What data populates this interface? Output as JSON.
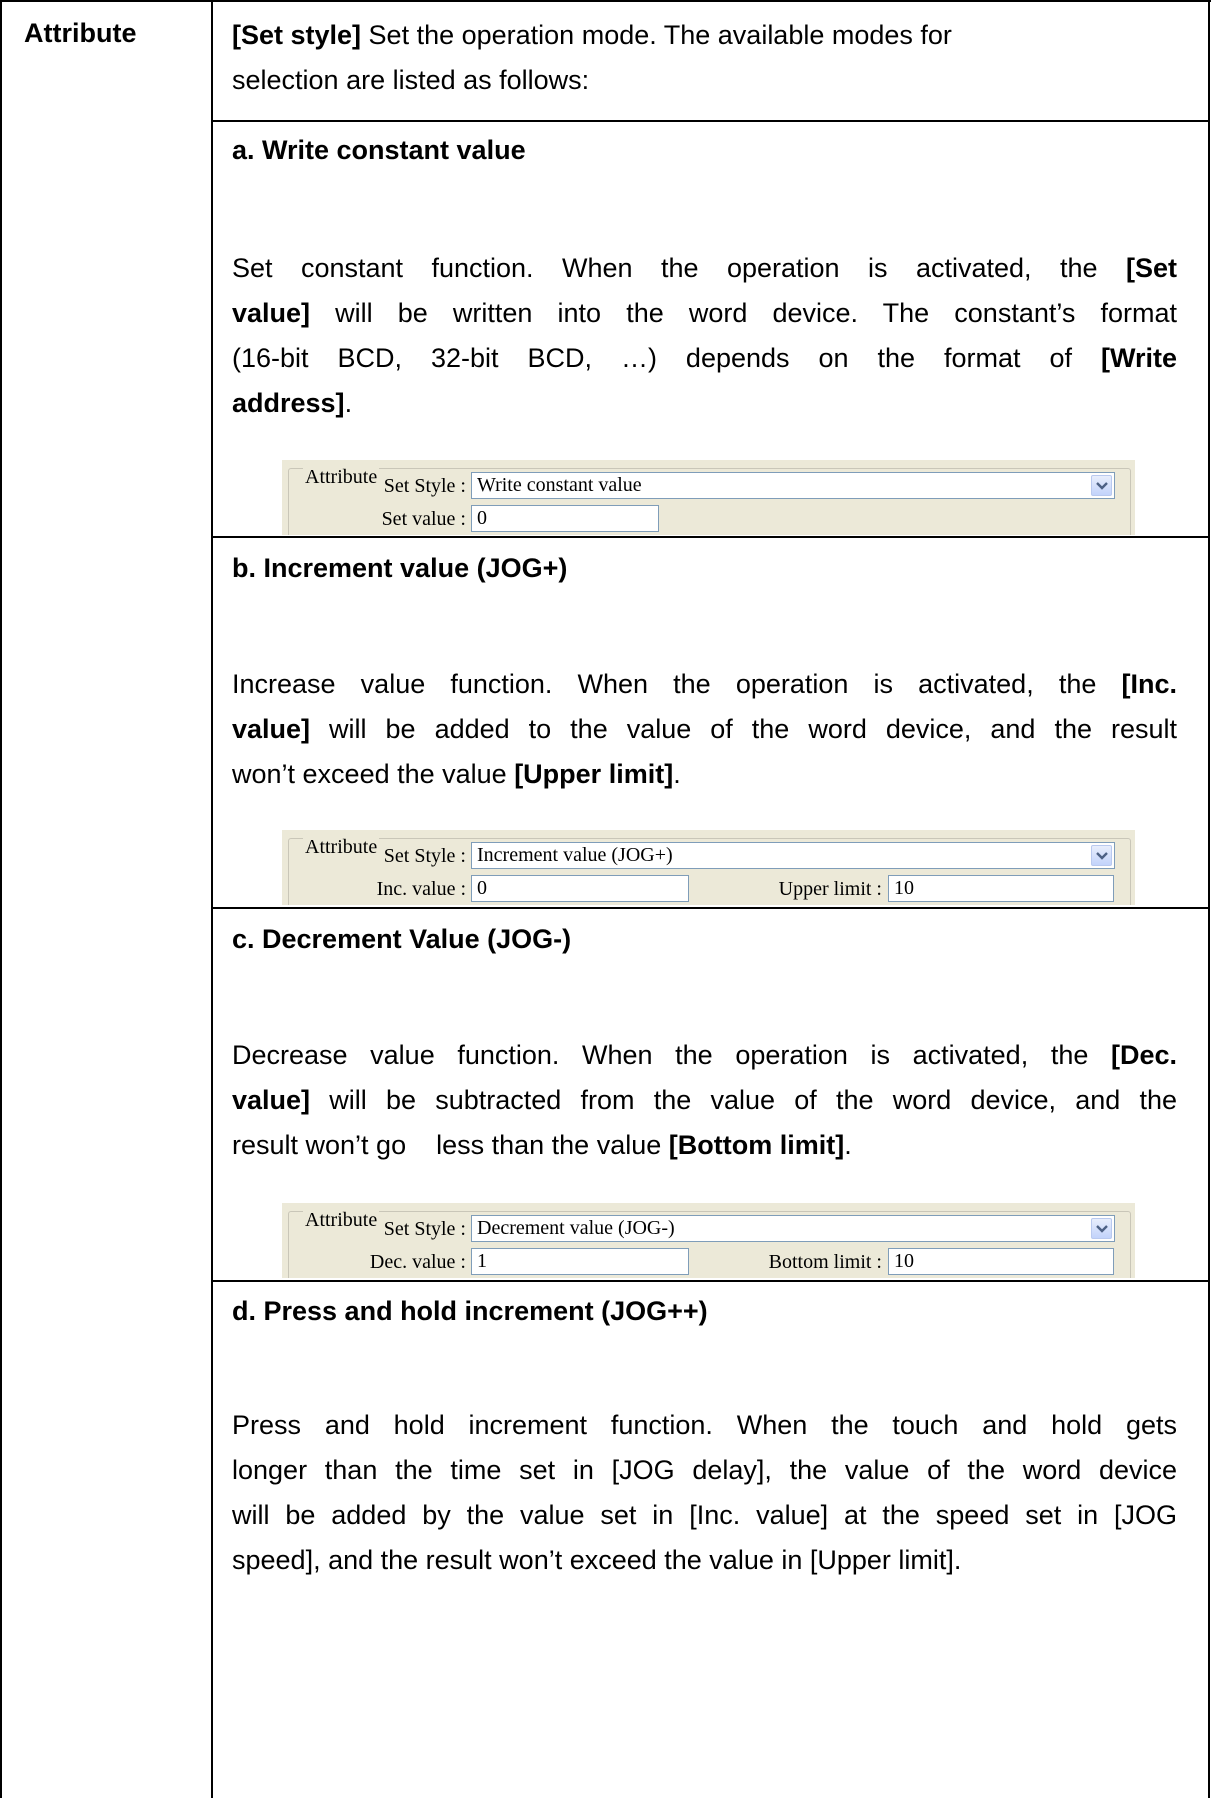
{
  "row_label": "Attribute",
  "intro": {
    "bold": "[Set style]",
    "line1_rest": " Set the operation mode. The available modes for",
    "line2": "selection are listed as follows:"
  },
  "sections": {
    "a": {
      "heading": "a. Write constant value",
      "l1a": "Set constant function. When the operation is activated, the ",
      "l1b": "[Set",
      "l2a": "value]",
      "l2b": " will be written into the word device. The constant’s format",
      "l3a": "(16-bit BCD, 32-bit BCD, …) depends on the format of ",
      "l3b": "[Write",
      "l4a": "address]",
      "l4b": ".",
      "panel": {
        "legend": "Attribute",
        "style_label": "Set Style :",
        "style_value": "Write constant value",
        "f1_label": "Set value :",
        "f1_value": "0"
      }
    },
    "b": {
      "heading": "b. Increment value (JOG+)",
      "l1a": "Increase value function. When the operation is activated, the ",
      "l1b": "[Inc.",
      "l2a": "value]",
      "l2b": " will be added to the value of the word device, and the result",
      "l3a": "won’t exceed the value ",
      "l3b": "[Upper limit]",
      "l3c": ".",
      "panel": {
        "legend": "Attribute",
        "style_label": "Set Style :",
        "style_value": "Increment value (JOG+)",
        "f1_label": "Inc. value :",
        "f1_value": "0",
        "f2_label": "Upper limit :",
        "f2_value": "10"
      }
    },
    "c": {
      "heading": "c. Decrement Value (JOG-)",
      "l1a": "Decrease value function. When the operation is activated, the ",
      "l1b": "[Dec.",
      "l2a": "value]",
      "l2b": " will be subtracted from the value of the word device, and the",
      "l3a": "result won’t go    less than the value ",
      "l3b": "[Bottom limit]",
      "l3c": ".",
      "panel": {
        "legend": "Attribute",
        "style_label": "Set Style :",
        "style_value": "Decrement value (JOG-)",
        "f1_label": "Dec. value :",
        "f1_value": "1",
        "f2_label": "Bottom limit :",
        "f2_value": "10"
      }
    },
    "d": {
      "heading": "d. Press and hold increment (JOG++)",
      "l1": "Press and hold increment function. When the touch and hold gets",
      "l2": "longer than the time set in [JOG delay], the value of the word device",
      "l3": "will be added by the value set in [Inc. value] at the speed set in [JOG",
      "l4": "speed], and the result won’t exceed the value in [Upper limit]."
    }
  }
}
